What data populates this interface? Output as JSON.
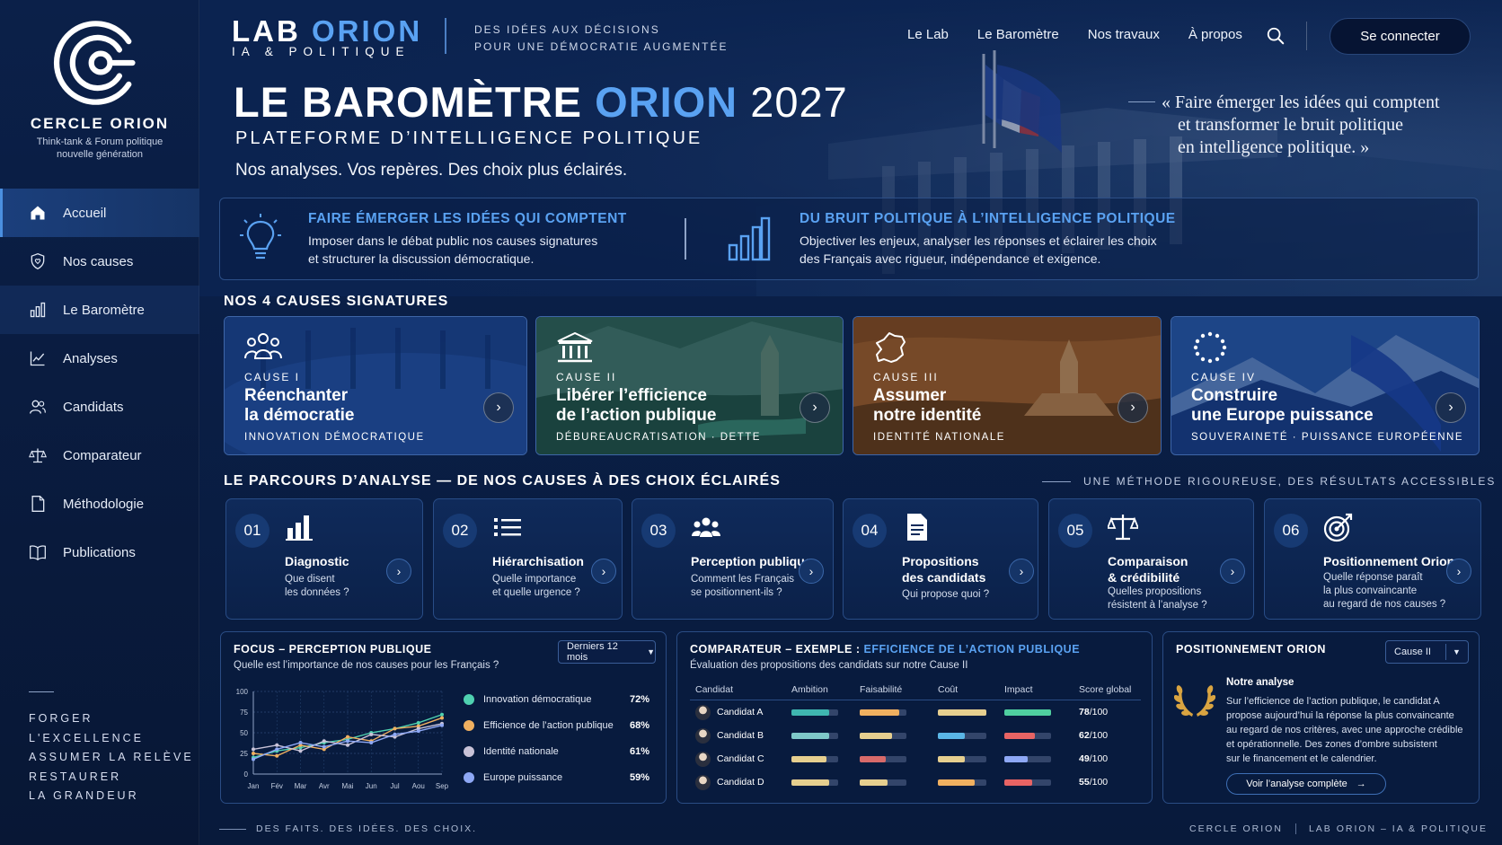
{
  "sidebar": {
    "org_name": "CERCLE ORION",
    "org_sub": "Think-tank & Forum politique nouvelle génération",
    "nav": [
      {
        "label": "Accueil",
        "icon": "home-icon",
        "active": true
      },
      {
        "label": "Nos causes",
        "icon": "shield-heart-icon"
      },
      {
        "label": "Le Baromètre",
        "icon": "bar-chart-icon"
      },
      {
        "label": "Analyses",
        "icon": "line-chart-icon"
      },
      {
        "label": "Candidats",
        "icon": "users-icon"
      },
      {
        "label": "Comparateur",
        "icon": "scale-icon"
      },
      {
        "label": "Méthodologie",
        "icon": "document-icon"
      },
      {
        "label": "Publications",
        "icon": "book-icon"
      }
    ],
    "motto": [
      "FORGER",
      "L'EXCELLENCE",
      "ASSUMER LA RELÈVE",
      "RESTAURER",
      "LA GRANDEUR"
    ]
  },
  "header": {
    "brand_lab": "LAB",
    "brand_orion": "ORION",
    "brand_sub": "IA & POLITIQUE",
    "tagline_1": "DES IDÉES AUX DÉCISIONS",
    "tagline_2": "POUR UNE DÉMOCRATIE AUGMENTÉE",
    "nav": [
      "Le Lab",
      "Le Baromètre",
      "Nos travaux",
      "À propos"
    ],
    "login": "Se connecter"
  },
  "hero": {
    "title_a": "LE BAROMÈTRE",
    "title_b": "ORION",
    "title_c": "2027",
    "subtitle": "PLATEFORME D’INTELLIGENCE POLITIQUE",
    "lead": "Nos analyses. Vos repères. Des choix plus éclairés.",
    "quote_1": "« Faire émerger les idées qui comptent",
    "quote_2": "et transformer le bruit politique",
    "quote_3": "en intelligence politique. »"
  },
  "mission": [
    {
      "title": "FAIRE ÉMERGER LES IDÉES QUI COMPTENT",
      "line1": "Imposer dans le débat public nos causes signatures",
      "line2": "et structurer la discussion démocratique."
    },
    {
      "title": "DU BRUIT POLITIQUE À L’INTELLIGENCE POLITIQUE",
      "line1": "Objectiver les enjeux, analyser les réponses et éclairer les choix",
      "line2": "des Français avec rigueur, indépendance et exigence."
    }
  ],
  "causes_title": "NOS 4 CAUSES SIGNATURES",
  "causes": [
    {
      "num": "CAUSE I",
      "name1": "Réenchanter",
      "name2": "la démocratie",
      "tag": "INNOVATION DÉMOCRATIQUE",
      "icon": "assembly-icon"
    },
    {
      "num": "CAUSE II",
      "name1": "Libérer l’efficience",
      "name2": "de l’action publique",
      "tag": "DÉBUREAUCRATISATION · DETTE",
      "icon": "institution-icon"
    },
    {
      "num": "CAUSE III",
      "name1": "Assumer",
      "name2": "notre identité",
      "tag": "IDENTITÉ NATIONALE",
      "icon": "france-map-icon"
    },
    {
      "num": "CAUSE IV",
      "name1": "Construire",
      "name2": "une Europe puissance",
      "tag": "SOUVERAINETÉ · PUISSANCE EUROPÉENNE",
      "icon": "eu-stars-icon"
    }
  ],
  "parcours": {
    "title": "LE PARCOURS D’ANALYSE — DE NOS CAUSES À DES CHOIX ÉCLAIRÉS",
    "right": "UNE MÉTHODE RIGOUREUSE, DES RÉSULTATS ACCESSIBLES",
    "steps": [
      {
        "n": "01",
        "title": "Diagnostic",
        "q": "Que disent\nles données ?",
        "icon": "bar-chart-icon"
      },
      {
        "n": "02",
        "title": "Hiérarchisation",
        "q": "Quelle importance\net quelle urgence ?",
        "icon": "list-icon"
      },
      {
        "n": "03",
        "title": "Perception publique",
        "q": "Comment les Français\nse positionnent-ils ?",
        "icon": "people-icon"
      },
      {
        "n": "04",
        "title": "Propositions\ndes candidats",
        "q": "Qui propose quoi ?",
        "icon": "document-icon"
      },
      {
        "n": "05",
        "title": "Comparaison\n& crédibilité",
        "q": "Quelles propositions\nrésistent à l’analyse ?",
        "icon": "scale-icon"
      },
      {
        "n": "06",
        "title": "Positionnement Orion",
        "q": "Quelle réponse paraît\nla plus convaincante\nau regard de nos causes ?",
        "icon": "target-icon"
      }
    ]
  },
  "focus": {
    "title": "FOCUS – PERCEPTION PUBLIQUE",
    "sub": "Quelle est l’importance de nos causes pour les Français ?",
    "filter": "Derniers 12 mois",
    "legend": [
      {
        "name": "Innovation démocratique",
        "value": "72%",
        "color": "#4fd1b0"
      },
      {
        "name": "Efficience de l’action publique",
        "value": "68%",
        "color": "#f0b060"
      },
      {
        "name": "Identité nationale",
        "value": "61%",
        "color": "#c9c3d8"
      },
      {
        "name": "Europe puissance",
        "value": "59%",
        "color": "#8ea8f5"
      }
    ]
  },
  "chart_data": {
    "type": "line",
    "x": [
      "Jan",
      "Fév",
      "Mar",
      "Avr",
      "Mai",
      "Jun",
      "Jul",
      "Aou",
      "Sep"
    ],
    "ylim": [
      0,
      100
    ],
    "yticks": [
      0,
      25,
      50,
      75,
      100
    ],
    "grid": true,
    "series": [
      {
        "name": "Innovation démocratique",
        "color": "#4fd1b0",
        "values": [
          20,
          28,
          32,
          38,
          42,
          50,
          55,
          62,
          72
        ]
      },
      {
        "name": "Efficience de l’action publique",
        "color": "#f0b060",
        "values": [
          25,
          22,
          35,
          30,
          45,
          40,
          55,
          58,
          68
        ]
      },
      {
        "name": "Identité nationale",
        "color": "#c9c3d8",
        "values": [
          30,
          35,
          28,
          40,
          35,
          48,
          45,
          55,
          61
        ]
      },
      {
        "name": "Europe puissance",
        "color": "#8ea8f5",
        "values": [
          18,
          30,
          38,
          33,
          40,
          38,
          48,
          52,
          59
        ]
      }
    ]
  },
  "comparateur": {
    "title_a": "COMPARATEUR – EXEMPLE :",
    "title_b": "EFFICIENCE DE L’ACTION PUBLIQUE",
    "sub": "Évaluation des propositions des candidats sur notre Cause II",
    "headers": [
      "Candidat",
      "Ambition",
      "Faisabilité",
      "Coût",
      "Impact",
      "Score global"
    ],
    "rows": [
      {
        "name": "Candidat A",
        "score": "78",
        "bars": [
          0.8,
          0.85,
          1.0,
          1.0
        ],
        "colors": [
          "#3fb6b0",
          "#f0b060",
          "#e6cf8f",
          "#4fcf9f"
        ]
      },
      {
        "name": "Candidat B",
        "score": "62",
        "bars": [
          0.8,
          0.7,
          0.55,
          0.65
        ],
        "colors": [
          "#7ec8c8",
          "#e6cf8f",
          "#5ab6e6",
          "#e86464"
        ]
      },
      {
        "name": "Candidat C",
        "score": "49",
        "bars": [
          0.75,
          0.55,
          0.55,
          0.5
        ],
        "colors": [
          "#e6cf8f",
          "#d86a6a",
          "#e6cf8f",
          "#8ea8f5"
        ]
      },
      {
        "name": "Candidat D",
        "score": "55",
        "bars": [
          0.8,
          0.6,
          0.75,
          0.6
        ],
        "colors": [
          "#e6cf8f",
          "#e6cf8f",
          "#f0b060",
          "#e86464"
        ]
      }
    ],
    "score_suffix": "/100"
  },
  "position": {
    "title": "POSITIONNEMENT ORION",
    "filter": "Cause II",
    "heading": "Notre analyse",
    "lines": [
      "Sur l’efficience de l’action publique, le candidat A",
      "propose aujourd’hui la réponse la plus convaincante",
      "au regard de nos critères, avec une approche crédible",
      "et opérationnelle. Des zones d’ombre subsistent",
      "sur le financement et le calendrier."
    ],
    "cta": "Voir l’analyse complète"
  },
  "footer": {
    "left": "DES FAITS. DES IDÉES. DES CHOIX.",
    "right_1": "CERCLE ORION",
    "right_2": "LAB ORION – IA & POLITIQUE"
  }
}
